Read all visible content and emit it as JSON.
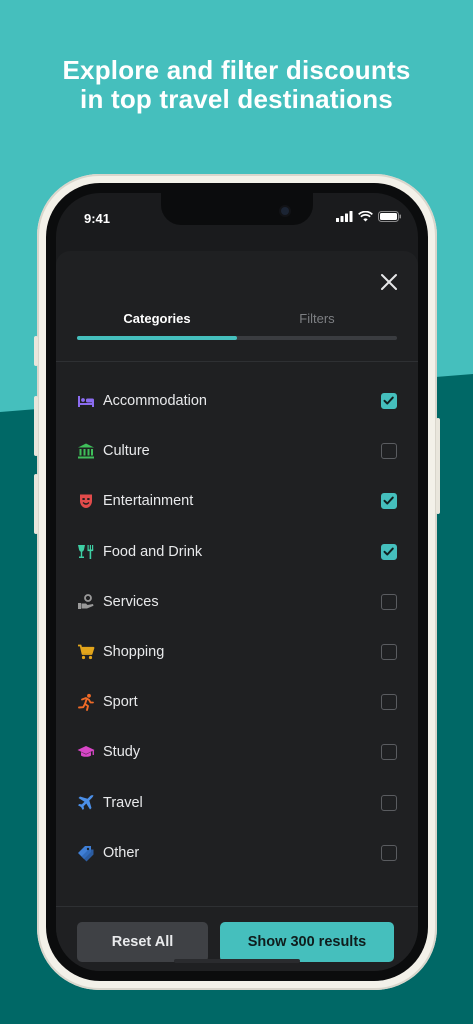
{
  "headline": {
    "line1": "Explore and filter discounts",
    "line2": "in top travel destinations"
  },
  "status_bar": {
    "time": "9:41"
  },
  "sheet": {
    "close_icon": "close-icon",
    "tabs": [
      {
        "label": "Categories",
        "active": true
      },
      {
        "label": "Filters",
        "active": false
      }
    ],
    "categories": [
      {
        "label": "Accommodation",
        "icon": "bed-icon",
        "color": "#8b6cf0",
        "checked": true
      },
      {
        "label": "Culture",
        "icon": "museum-icon",
        "color": "#3fbf5a",
        "checked": false
      },
      {
        "label": "Entertainment",
        "icon": "theater-mask-icon",
        "color": "#e24b4b",
        "checked": true
      },
      {
        "label": "Food and Drink",
        "icon": "food-drink-icon",
        "color": "#3ecfa4",
        "checked": true
      },
      {
        "label": "Services",
        "icon": "service-hand-icon",
        "color": "#9a9a9a",
        "checked": false
      },
      {
        "label": "Shopping",
        "icon": "shopping-cart-icon",
        "color": "#e3a51b",
        "checked": false
      },
      {
        "label": "Sport",
        "icon": "running-icon",
        "color": "#ef6a27",
        "checked": false
      },
      {
        "label": "Study",
        "icon": "graduation-cap-icon",
        "color": "#d846c7",
        "checked": false
      },
      {
        "label": "Travel",
        "icon": "airplane-icon",
        "color": "#4b8fe8",
        "checked": false
      },
      {
        "label": "Other",
        "icon": "tags-icon",
        "color": "#3f7fd6",
        "checked": false
      }
    ],
    "footer": {
      "reset_label": "Reset All",
      "show_label": "Show 300 results"
    }
  },
  "colors": {
    "accent": "#45bfbd",
    "background_top": "#45bfbd",
    "background_bottom": "#006866",
    "sheet": "#1f2022"
  }
}
